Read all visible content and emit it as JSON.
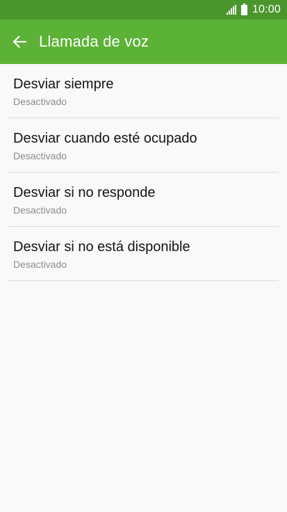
{
  "status_bar": {
    "time": "10:00",
    "icons": [
      "signal-icon",
      "battery-icon"
    ]
  },
  "header": {
    "title": "Llamada de voz",
    "back_icon": "back-arrow-icon"
  },
  "colors": {
    "status_bar_bg": "#4a962d",
    "app_bar_bg": "#5cb236",
    "background": "#f9f9f9",
    "title_text": "#141414",
    "subtitle_text": "#8c8c8c",
    "divider": "#dcdcdc"
  },
  "list": {
    "items": [
      {
        "title": "Desviar siempre",
        "subtitle": "Desactivado"
      },
      {
        "title": "Desviar cuando esté ocupado",
        "subtitle": "Desactivado"
      },
      {
        "title": "Desviar si no responde",
        "subtitle": "Desactivado"
      },
      {
        "title": "Desviar si no está disponible",
        "subtitle": "Desactivado"
      }
    ]
  }
}
